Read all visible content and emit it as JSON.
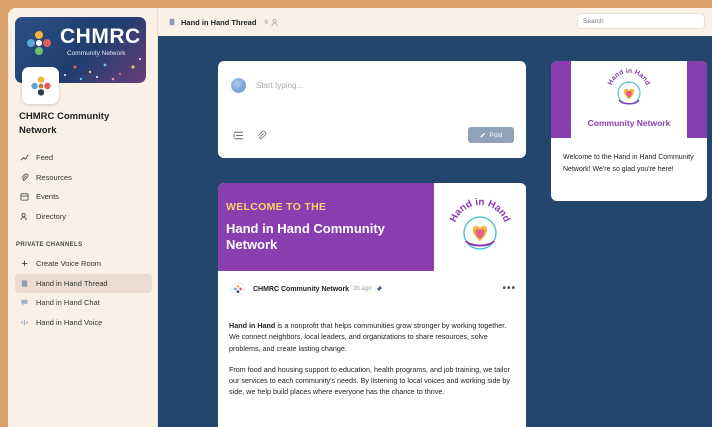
{
  "sidebar": {
    "banner_title": "CHMRC",
    "banner_subtitle": "Community Network",
    "server_name": "CHMRC Community Network",
    "nav": [
      {
        "label": "Feed",
        "icon": "trending-icon"
      },
      {
        "label": "Resources",
        "icon": "paperclip-icon"
      },
      {
        "label": "Events",
        "icon": "calendar-icon"
      },
      {
        "label": "Directory",
        "icon": "people-icon"
      }
    ],
    "section_label": "PRIVATE CHANNELS",
    "channels": [
      {
        "label": "Create Voice Room",
        "icon": "plus-icon"
      },
      {
        "label": "Hand in Hand Thread",
        "icon": "thread-icon",
        "active": true
      },
      {
        "label": "Hand in Hand Chat",
        "icon": "chat-icon"
      },
      {
        "label": "Hand in Hand Voice",
        "icon": "voice-icon"
      }
    ]
  },
  "topbar": {
    "title": "Hand in Hand Thread",
    "member_count": "6",
    "search_placeholder": "Search"
  },
  "composer": {
    "placeholder": "Start typing...",
    "post_label": "Post"
  },
  "post": {
    "hero_kicker": "WELCOME TO THE",
    "hero_title": "Hand in Hand Community Network",
    "author": "CHMRC Community Network",
    "time": "3h ago",
    "more": "•••",
    "body_bold": "Hand in Hand",
    "body_p1_rest": " is a nonprofit that helps communities grow stronger by working together. We connect neighbors, local leaders, and organizations to share resources, solve problems, and create lasting change.",
    "body_p2": "From food and housing support to education, health programs, and job training, we tailor our services to each community's needs. By listening to local voices and working side by side, we help build places where everyone has the chance to thrive."
  },
  "side_card": {
    "caption": "Community Network",
    "text": "Welcome to the Hand in Hand Community Network! We're so glad you're here!"
  },
  "logo": {
    "arc_text": "Hand in Hand"
  },
  "colors": {
    "purple": "#8a3fb0",
    "navy": "#23466d",
    "sidebar_bg": "#fbf0e6",
    "accent_yellow": "#f4d36a"
  }
}
